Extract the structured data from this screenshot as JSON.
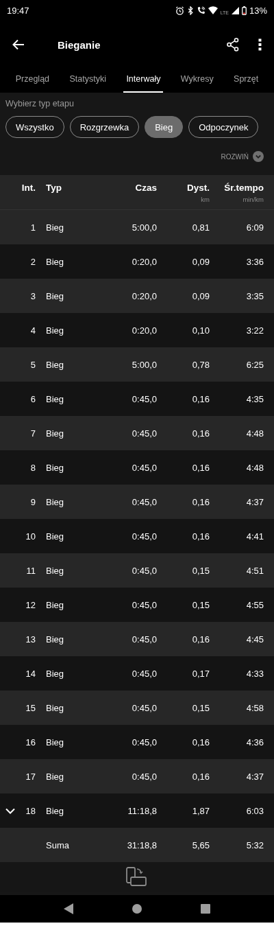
{
  "status_bar": {
    "time": "19:47",
    "network": "LTE",
    "battery": "13%"
  },
  "app_bar": {
    "title": "Bieganie"
  },
  "tabs": [
    {
      "label": "Przegląd",
      "selected": false
    },
    {
      "label": "Statystyki",
      "selected": false
    },
    {
      "label": "Interwały",
      "selected": true
    },
    {
      "label": "Wykresy",
      "selected": false
    },
    {
      "label": "Sprzęt",
      "selected": false
    }
  ],
  "filter": {
    "label": "Wybierz typ etapu",
    "chips": [
      {
        "label": "Wszystko",
        "selected": false
      },
      {
        "label": "Rozgrzewka",
        "selected": false
      },
      {
        "label": "Bieg",
        "selected": true
      },
      {
        "label": "Odpoczynek",
        "selected": false
      }
    ]
  },
  "expand_all": "ROZWIŃ",
  "table": {
    "columns": [
      {
        "title": "Int."
      },
      {
        "title": "Typ"
      },
      {
        "title": "Czas"
      },
      {
        "title": "Dyst.",
        "unit": "km"
      },
      {
        "title": "Śr.tempo",
        "unit": "min/km"
      }
    ],
    "rows": [
      {
        "int": "1",
        "type": "Bieg",
        "time": "5:00,0",
        "dist": "0,81",
        "pace": "6:09",
        "expandable": false
      },
      {
        "int": "2",
        "type": "Bieg",
        "time": "0:20,0",
        "dist": "0,09",
        "pace": "3:36",
        "expandable": false
      },
      {
        "int": "3",
        "type": "Bieg",
        "time": "0:20,0",
        "dist": "0,09",
        "pace": "3:35",
        "expandable": false
      },
      {
        "int": "4",
        "type": "Bieg",
        "time": "0:20,0",
        "dist": "0,10",
        "pace": "3:22",
        "expandable": false
      },
      {
        "int": "5",
        "type": "Bieg",
        "time": "5:00,0",
        "dist": "0,78",
        "pace": "6:25",
        "expandable": false
      },
      {
        "int": "6",
        "type": "Bieg",
        "time": "0:45,0",
        "dist": "0,16",
        "pace": "4:35",
        "expandable": false
      },
      {
        "int": "7",
        "type": "Bieg",
        "time": "0:45,0",
        "dist": "0,16",
        "pace": "4:48",
        "expandable": false
      },
      {
        "int": "8",
        "type": "Bieg",
        "time": "0:45,0",
        "dist": "0,16",
        "pace": "4:48",
        "expandable": false
      },
      {
        "int": "9",
        "type": "Bieg",
        "time": "0:45,0",
        "dist": "0,16",
        "pace": "4:37",
        "expandable": false
      },
      {
        "int": "10",
        "type": "Bieg",
        "time": "0:45,0",
        "dist": "0,16",
        "pace": "4:41",
        "expandable": false
      },
      {
        "int": "11",
        "type": "Bieg",
        "time": "0:45,0",
        "dist": "0,15",
        "pace": "4:51",
        "expandable": false
      },
      {
        "int": "12",
        "type": "Bieg",
        "time": "0:45,0",
        "dist": "0,15",
        "pace": "4:55",
        "expandable": false
      },
      {
        "int": "13",
        "type": "Bieg",
        "time": "0:45,0",
        "dist": "0,16",
        "pace": "4:45",
        "expandable": false
      },
      {
        "int": "14",
        "type": "Bieg",
        "time": "0:45,0",
        "dist": "0,17",
        "pace": "4:33",
        "expandable": false
      },
      {
        "int": "15",
        "type": "Bieg",
        "time": "0:45,0",
        "dist": "0,15",
        "pace": "4:58",
        "expandable": false
      },
      {
        "int": "16",
        "type": "Bieg",
        "time": "0:45,0",
        "dist": "0,16",
        "pace": "4:36",
        "expandable": false
      },
      {
        "int": "17",
        "type": "Bieg",
        "time": "0:45,0",
        "dist": "0,16",
        "pace": "4:37",
        "expandable": false
      },
      {
        "int": "18",
        "type": "Bieg",
        "time": "11:18,8",
        "dist": "1,87",
        "pace": "6:03",
        "expandable": true
      }
    ],
    "total": {
      "label": "Suma",
      "time": "31:18,8",
      "dist": "5,65",
      "pace": "5:32"
    }
  }
}
